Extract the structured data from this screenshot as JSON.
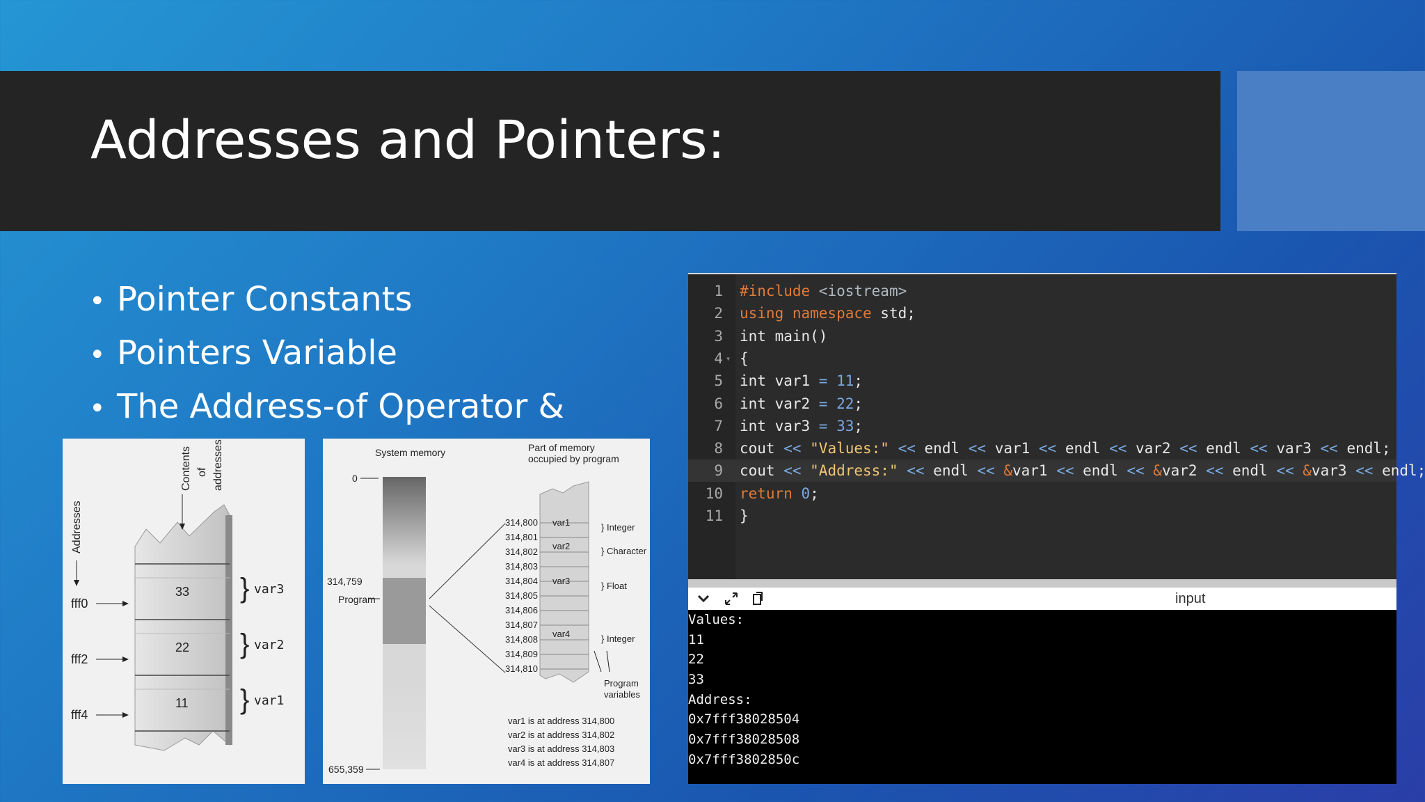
{
  "slide": {
    "title": "Addresses and Pointers:",
    "bullets": [
      "Pointer Constants",
      "Pointers Variable",
      "The Address-of Operator &"
    ]
  },
  "diagram1": {
    "axis_label": "Addresses",
    "contents_label": [
      "Contents",
      "of",
      "addresses"
    ],
    "rows": [
      {
        "address": "fff0",
        "value": "33",
        "var": "var3"
      },
      {
        "address": "fff2",
        "value": "22",
        "var": "var2"
      },
      {
        "address": "fff4",
        "value": "11",
        "var": "var1"
      }
    ]
  },
  "diagram2": {
    "system_memory_label": "System memory",
    "part_label": [
      "Part of memory",
      "occupied by program"
    ],
    "start_address": "0",
    "program_address": "314,759",
    "program_label": "Program",
    "end_address": "655,359",
    "addresses": [
      "314,800",
      "314,801",
      "314,802",
      "314,803",
      "314,804",
      "314,805",
      "314,806",
      "314,807",
      "314,808",
      "314,809",
      "314,810"
    ],
    "vars": [
      {
        "name": "var1",
        "type": "Integer"
      },
      {
        "name": "var2",
        "type": "Character"
      },
      {
        "name": "var3",
        "type": "Float"
      },
      {
        "name": "var4",
        "type": "Integer"
      }
    ],
    "program_variables_label": [
      "Program",
      "variables"
    ],
    "notes": [
      "var1 is at address 314,800",
      "var2 is at address 314,802",
      "var3 is at address 314,803",
      "var4 is at address 314,807"
    ]
  },
  "editor": {
    "lines": [
      {
        "n": "1",
        "tokens": [
          [
            "inc",
            "#include "
          ],
          [
            "hdr",
            "<iostream>"
          ]
        ]
      },
      {
        "n": "2",
        "tokens": [
          [
            "kw",
            "using namespace "
          ],
          [
            "",
            "std;"
          ]
        ]
      },
      {
        "n": "3",
        "tokens": [
          [
            "",
            "int main()"
          ]
        ]
      },
      {
        "n": "4",
        "tokens": [
          [
            "",
            "{"
          ]
        ]
      },
      {
        "n": "5",
        "tokens": [
          [
            "",
            "int var1 "
          ],
          [
            "num",
            "= 11"
          ],
          [
            "",
            ";"
          ]
        ]
      },
      {
        "n": "6",
        "tokens": [
          [
            "",
            "int var2 "
          ],
          [
            "num",
            "= 22"
          ],
          [
            "",
            ";"
          ]
        ]
      },
      {
        "n": "7",
        "tokens": [
          [
            "",
            "int var3 "
          ],
          [
            "num",
            "= 33"
          ],
          [
            "",
            ";"
          ]
        ]
      },
      {
        "n": "8",
        "tokens": [
          [
            "",
            "cout "
          ],
          [
            "num",
            "<< "
          ],
          [
            "str",
            "\"Values:\""
          ],
          [
            "num",
            " << "
          ],
          [
            "",
            "endl"
          ],
          [
            "num",
            " << "
          ],
          [
            "",
            "var1"
          ],
          [
            "num",
            " << "
          ],
          [
            "",
            "endl"
          ],
          [
            "num",
            " << "
          ],
          [
            "",
            "var2"
          ],
          [
            "num",
            " << "
          ],
          [
            "",
            "endl"
          ],
          [
            "num",
            " << "
          ],
          [
            "",
            "var3"
          ],
          [
            "num",
            " << "
          ],
          [
            "",
            "endl;"
          ]
        ]
      },
      {
        "n": "9",
        "tokens": [
          [
            "",
            "cout "
          ],
          [
            "num",
            "<< "
          ],
          [
            "str",
            "\"Address:\""
          ],
          [
            "num",
            " << "
          ],
          [
            "",
            "endl"
          ],
          [
            "num",
            " << "
          ],
          [
            "amp",
            "&"
          ],
          [
            "",
            "var1"
          ],
          [
            "num",
            " << "
          ],
          [
            "",
            "endl"
          ],
          [
            "num",
            " << "
          ],
          [
            "amp",
            "&"
          ],
          [
            "",
            "var2"
          ],
          [
            "num",
            " << "
          ],
          [
            "",
            "endl"
          ],
          [
            "num",
            " << "
          ],
          [
            "amp",
            "&"
          ],
          [
            "",
            "var3"
          ],
          [
            "num",
            " << "
          ],
          [
            "",
            "endl;"
          ]
        ]
      },
      {
        "n": "10",
        "tokens": [
          [
            "kw",
            "return "
          ],
          [
            "num",
            "0"
          ],
          [
            "",
            ";"
          ]
        ]
      },
      {
        "n": "11",
        "tokens": [
          [
            "",
            "}"
          ]
        ]
      }
    ],
    "active_line": 8
  },
  "io": {
    "label": "input",
    "output": [
      "Values:",
      "11",
      "22",
      "33",
      "Address:",
      "0x7fff38028504",
      "0x7fff38028508",
      "0x7fff3802850c"
    ]
  }
}
